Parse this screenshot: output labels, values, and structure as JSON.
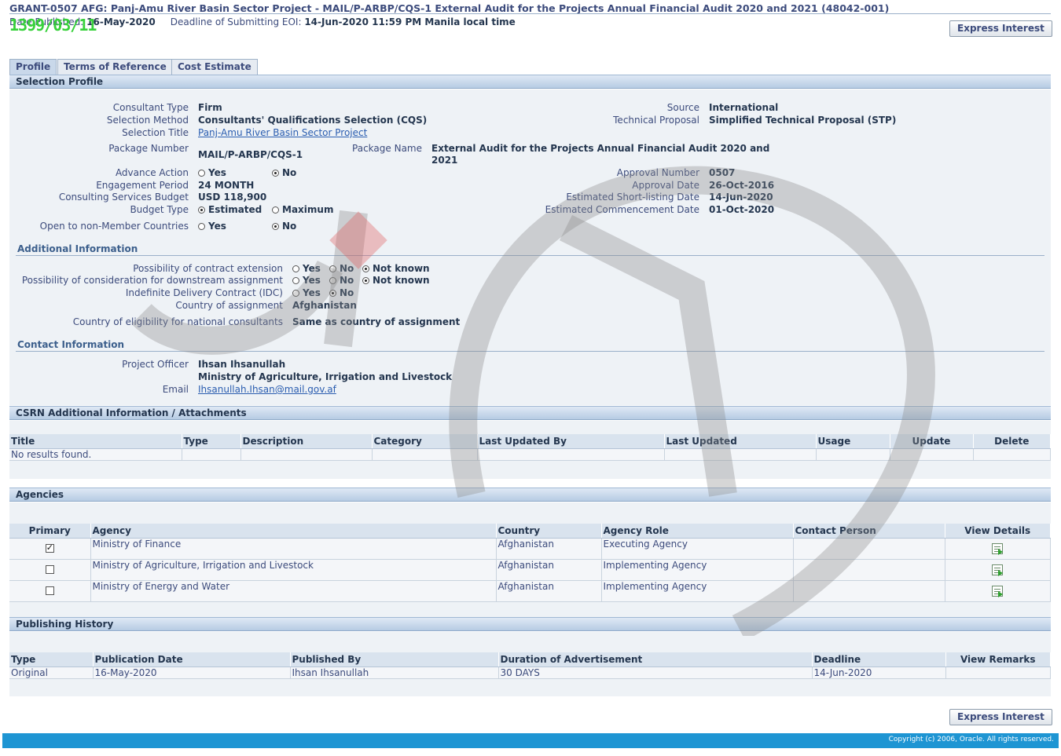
{
  "header": {
    "title": "GRANT-0507 AFG: Panj-Amu River Basin Sector Project - MAIL/P-ARBP/CQS-1 External Audit for the Projects Annual Financial Audit 2020 and 2021 (48042-001)",
    "date_published_label": "Date Published",
    "date_published": "16-May-2020",
    "deadline_label": "Deadline of Submitting EOI:",
    "deadline_value": "14-Jun-2020 11:59 PM Manila local time",
    "express_interest": "Express Interest",
    "stamp": "1399/03/11"
  },
  "tabs": [
    {
      "label": "Profile",
      "active": true
    },
    {
      "label": "Terms of Reference",
      "active": false
    },
    {
      "label": "Cost Estimate",
      "active": false
    }
  ],
  "selection_profile": {
    "heading": "Selection Profile",
    "consultant_type_label": "Consultant Type",
    "consultant_type": "Firm",
    "selection_method_label": "Selection Method",
    "selection_method": "Consultants' Qualifications Selection (CQS)",
    "selection_title_label": "Selection Title",
    "selection_title": "Panj-Amu River Basin Sector Project",
    "package_number_label": "Package Number",
    "package_number": "MAIL/P-ARBP/CQS-1",
    "package_name_label": "Package Name",
    "package_name_line1": "External Audit for the Projects Annual Financial Audit 2020 and",
    "package_name_line2": "2021",
    "advance_action_label": "Advance Action",
    "engagement_period_label": "Engagement Period",
    "engagement_period": "24 MONTH",
    "budget_label": "Consulting Services Budget",
    "budget": "USD 118,900",
    "budget_type_label": "Budget Type",
    "budget_type_estimated": "Estimated",
    "budget_type_maximum": "Maximum",
    "open_label": "Open to non-Member Countries",
    "source_label": "Source",
    "source": "International",
    "technical_proposal_label": "Technical Proposal",
    "technical_proposal": "Simplified Technical Proposal (STP)",
    "approval_number_label": "Approval Number",
    "approval_number": "0507",
    "approval_date_label": "Approval Date",
    "approval_date": "26-Oct-2016",
    "shortlisting_label": "Estimated Short-listing Date",
    "shortlisting_date": "14-Jun-2020",
    "commencement_label": "Estimated Commencement Date",
    "commencement_date": "01-Oct-2020",
    "yes": "Yes",
    "no": "No",
    "not_known": "Not known"
  },
  "additional_info": {
    "heading": "Additional Information",
    "extension_label": "Possibility of contract extension",
    "downstream_label": "Possibility of consideration for downstream assignment",
    "idc_label": "Indefinite Delivery Contract (IDC)",
    "country_label": "Country of assignment",
    "country": "Afghanistan",
    "eligibility_label": "Country of eligibility for national consultants",
    "eligibility": "Same as country of assignment"
  },
  "contact_info": {
    "heading": "Contact Information",
    "officer_label": "Project Officer",
    "officer_name": "Ihsan Ihsanullah",
    "officer_org": "Ministry of Agriculture, Irrigation and Livestock",
    "email_label": "Email",
    "email": "Ihsanullah.Ihsan@mail.gov.af"
  },
  "attachments": {
    "heading": "CSRN Additional Information / Attachments",
    "columns": [
      "Title",
      "Type",
      "Description",
      "Category",
      "Last Updated By",
      "Last Updated",
      "Usage",
      "Update",
      "Delete"
    ],
    "empty_text": "No results found."
  },
  "agencies": {
    "heading": "Agencies",
    "columns": [
      "Primary",
      "Agency",
      "Country",
      "Agency Role",
      "Contact Person",
      "View Details"
    ],
    "rows": [
      {
        "primary": true,
        "agency": "Ministry of Finance",
        "country": "Afghanistan",
        "role": "Executing Agency",
        "contact": ""
      },
      {
        "primary": false,
        "agency": "Ministry of Agriculture, Irrigation and Livestock",
        "country": "Afghanistan",
        "role": "Implementing Agency",
        "contact": ""
      },
      {
        "primary": false,
        "agency": "Ministry of Energy and Water",
        "country": "Afghanistan",
        "role": "Implementing Agency",
        "contact": ""
      }
    ]
  },
  "publishing_history": {
    "heading": "Publishing History",
    "columns": [
      "Type",
      "Publication Date",
      "Published By",
      "Duration of Advertisement",
      "Deadline",
      "View Remarks"
    ],
    "rows": [
      {
        "type": "Original",
        "date": "16-May-2020",
        "by": "Ihsan Ihsanullah",
        "duration": "30 DAYS",
        "deadline": "14-Jun-2020",
        "remarks": ""
      }
    ]
  },
  "footer": {
    "copyright": "Copyright (c) 2006, Oracle. All rights reserved."
  },
  "colors": {
    "link": "#2a5db0",
    "footer": "#1e95d3",
    "stamp": "#37d13a",
    "label": "#3c4b7c"
  }
}
